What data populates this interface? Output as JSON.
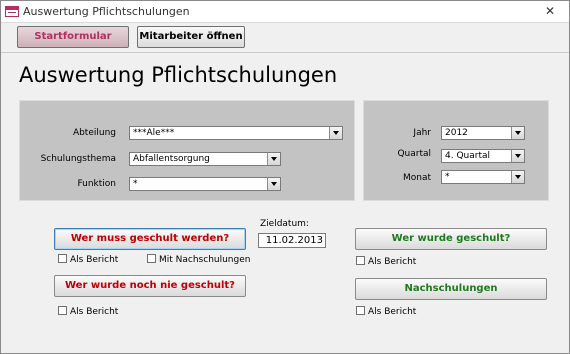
{
  "window": {
    "title": "Auswertung Pflichtschulungen",
    "close_glyph": "✕"
  },
  "toolbar": {
    "start_label": "Startformular",
    "mitarbeiter_label": "Mitarbeiter öffnen"
  },
  "heading": "Auswertung Pflichtschulungen",
  "filters": {
    "abteilung": {
      "label": "Abteilung",
      "value": "***Ale***"
    },
    "schulungsthema": {
      "label": "Schulungsthema",
      "value": "Abfallentsorgung"
    },
    "funktion": {
      "label": "Funktion",
      "value": "*"
    }
  },
  "period": {
    "jahr": {
      "label": "Jahr",
      "value": "2012"
    },
    "quartal": {
      "label": "Quartal",
      "value": "4. Quartal"
    },
    "monat": {
      "label": "Monat",
      "value": "*"
    }
  },
  "zieldatum": {
    "label": "Zieldatum:",
    "value": "11.02.2013"
  },
  "actions": {
    "muss_geschult": "Wer muss geschult werden?",
    "nie_geschult": "Wer wurde noch nie geschult?",
    "wurde_geschult": "Wer wurde geschult?",
    "nachschulungen": "Nachschulungen"
  },
  "checkboxes": {
    "als_bericht": "Als Bericht",
    "mit_nachschulungen": "Mit Nachschulungen"
  },
  "colors": {
    "accent_red": "#c00000",
    "accent_green": "#1e7a1e",
    "brand": "#b03060"
  }
}
